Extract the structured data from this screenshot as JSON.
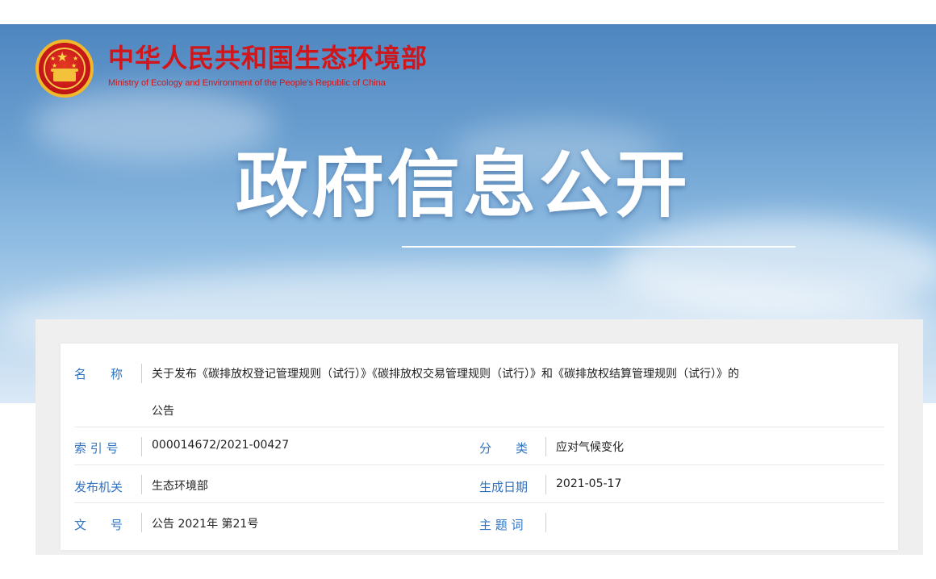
{
  "header": {
    "ministry_cn": "中华人民共和国生态环境部",
    "ministry_en": "Ministry of Ecology and Environment of the People's Republic of China",
    "banner_title": "政府信息公开"
  },
  "info": {
    "name": {
      "label": "名　　称",
      "value_line1": "关于发布《碳排放权登记管理规则（试行）》《碳排放权交易管理规则（试行）》和《碳排放权结算管理规则（试行）》的",
      "value_line2": "公告"
    },
    "index_no": {
      "label": "索 引 号",
      "value": "000014672/2021-00427"
    },
    "category": {
      "label": "分　　类",
      "value": "应对气候变化"
    },
    "publisher": {
      "label": "发布机关",
      "value": "生态环境部"
    },
    "created_date": {
      "label": "生成日期",
      "value": "2021-05-17"
    },
    "doc_no": {
      "label": "文　　号",
      "value": "公告 2021年 第21号"
    },
    "keywords": {
      "label": "主 题 词",
      "value": ""
    }
  },
  "colors": {
    "brand_red": "#d0161b",
    "label_blue": "#2f73c1"
  }
}
